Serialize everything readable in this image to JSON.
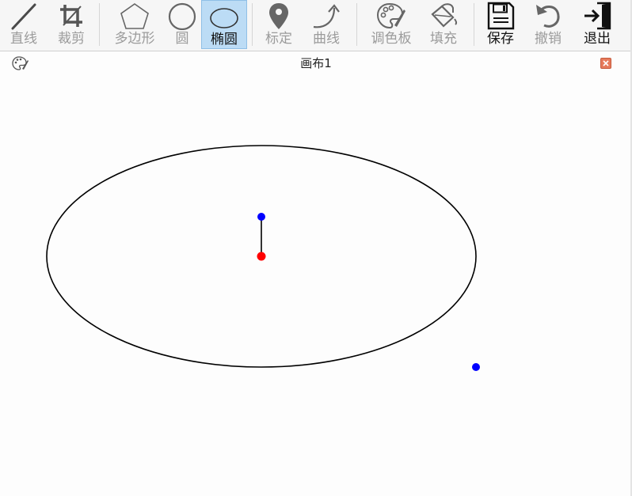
{
  "toolbar": {
    "tools": [
      {
        "id": "line",
        "label": "直线",
        "icon": "line-icon",
        "state": "disabled"
      },
      {
        "id": "crop",
        "label": "裁剪",
        "icon": "crop-icon",
        "state": "disabled"
      },
      {
        "id": "polygon",
        "label": "多边形",
        "icon": "pentagon-icon",
        "state": "disabled"
      },
      {
        "id": "circle",
        "label": "圆",
        "icon": "circle-icon",
        "state": "disabled"
      },
      {
        "id": "ellipse",
        "label": "椭圆",
        "icon": "ellipse-icon",
        "state": "active"
      },
      {
        "id": "mark",
        "label": "标定",
        "icon": "map-pin-icon",
        "state": "disabled"
      },
      {
        "id": "curve",
        "label": "曲线",
        "icon": "curved-arrow-icon",
        "state": "disabled"
      },
      {
        "id": "palette",
        "label": "调色板",
        "icon": "palette-icon",
        "state": "disabled"
      },
      {
        "id": "fill",
        "label": "填充",
        "icon": "paint-bucket-icon",
        "state": "disabled"
      },
      {
        "id": "save",
        "label": "保存",
        "icon": "floppy-disk-icon",
        "state": "enabled"
      },
      {
        "id": "undo",
        "label": "撤销",
        "icon": "undo-icon",
        "state": "disabled"
      },
      {
        "id": "exit",
        "label": "退出",
        "icon": "exit-door-icon",
        "state": "enabled"
      }
    ]
  },
  "canvas": {
    "title": "画布1",
    "icon": "palette-icon",
    "close_icon": "close-icon"
  },
  "drawing": {
    "shape": "ellipse",
    "stroke_color": "#000000",
    "center_handle_color": "#ff0000",
    "control_handle_color": "#0000ff"
  },
  "colors": {
    "toolbar_bg": "#f6f6f6",
    "active_tool_bg": "#bcdcf5",
    "disabled_label": "#9b9b9b",
    "close_button": "#e67a5c"
  }
}
